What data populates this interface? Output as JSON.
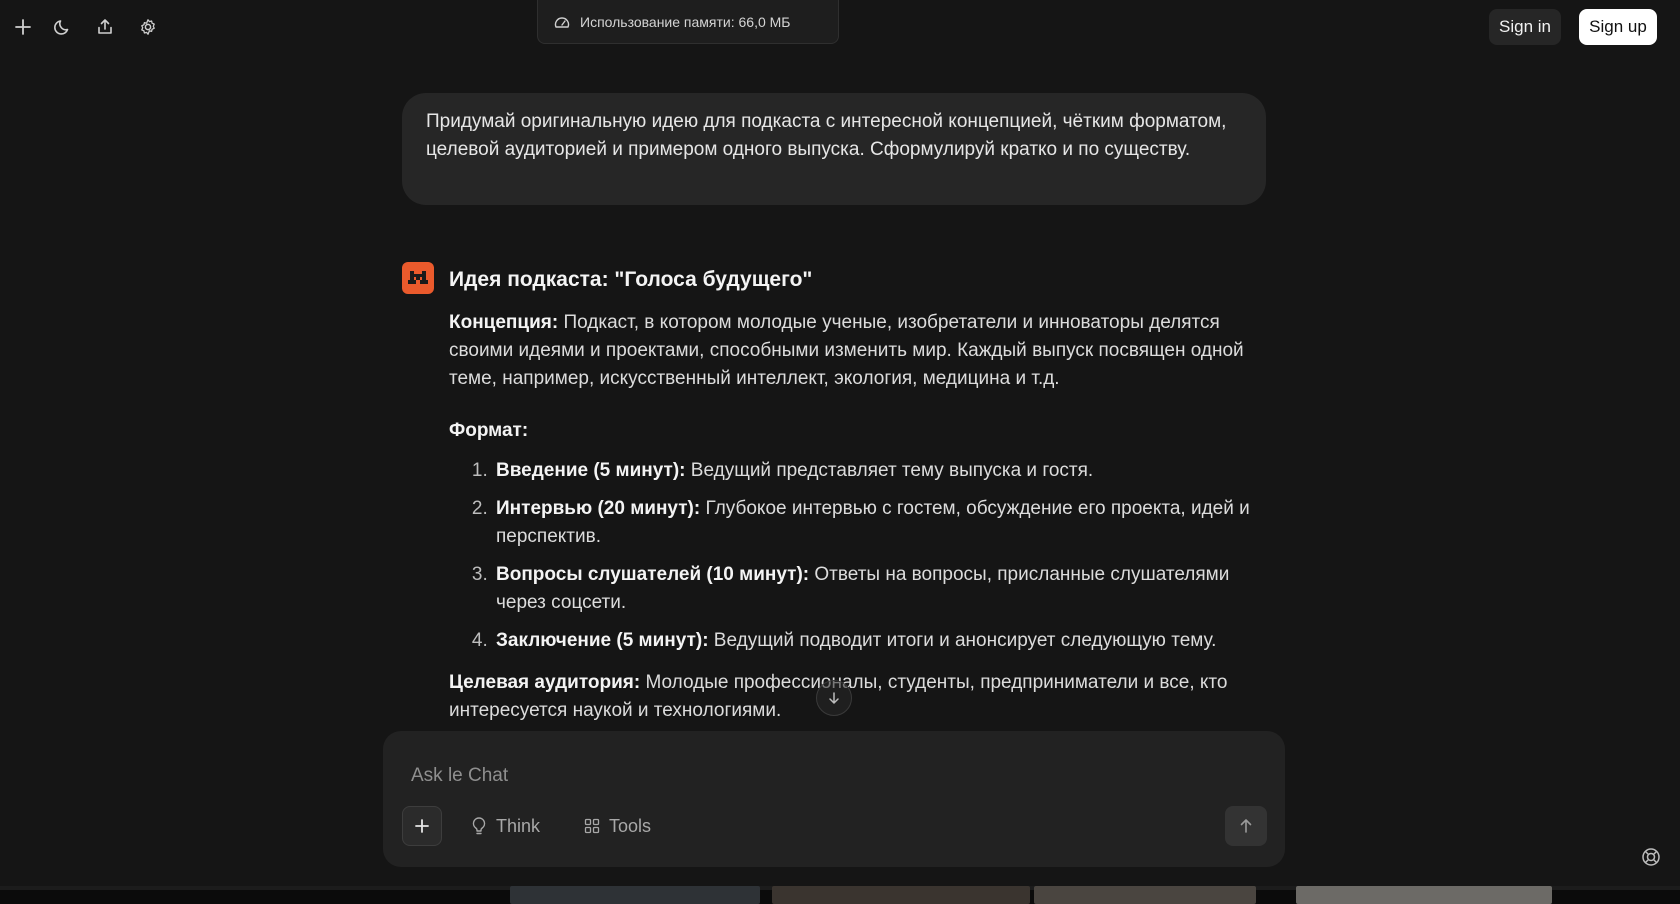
{
  "toolbar": {
    "new_chat_icon": "plus-icon",
    "theme_icon": "moon-icon",
    "share_icon": "share-icon",
    "settings_icon": "gear-icon"
  },
  "memory": {
    "icon": "gauge-icon",
    "text": "Использование памяти: 66,0 МБ"
  },
  "auth": {
    "sign_in": "Sign in",
    "sign_up": "Sign up"
  },
  "user_message": {
    "text": "Придумай оригинальную идею для подкаста с интересной концепцией, чётким форматом, целевой аудиторией и примером одного выпуска. Сформулируй кратко и по существу."
  },
  "assistant": {
    "avatar_icon": "cat-logo-icon",
    "heading": "Идея подкаста: \"Голоса будущего\"",
    "concept_label": "Концепция:",
    "concept_text": " Подкаст, в котором молодые ученые, изобретатели и инноваторы делятся своими идеями и проектами, способными изменить мир. Каждый выпуск посвящен одной теме, например, искусственный интеллект, экология, медицина и т.д.",
    "format_label": "Формат:",
    "format_items": [
      {
        "label": "Введение (5 минут):",
        "text": " Ведущий представляет тему выпуска и гостя."
      },
      {
        "label": "Интервью (20 минут):",
        "text": " Глубокое интервью с гостем, обсуждение его проекта, идей и перспектив."
      },
      {
        "label": "Вопросы слушателей (10 минут):",
        "text": " Ответы на вопросы, присланные слушателями через соцсети."
      },
      {
        "label": "Заключение (5 минут):",
        "text": " Ведущий подводит итоги и анонсирует следующую тему."
      }
    ],
    "audience_label": "Целевая аудитория:",
    "audience_text": " Молодые профессионалы, студенты, предприниматели и все, кто интересуется наукой и технологиями."
  },
  "composer": {
    "placeholder": "Ask le Chat",
    "add_icon": "plus-icon",
    "think_icon": "lightbulb-icon",
    "think_label": "Think",
    "tools_icon": "grid-icon",
    "tools_label": "Tools",
    "send_icon": "arrow-up-icon"
  },
  "help_icon": "lifebuoy-icon",
  "colors": {
    "background": "#151515",
    "bubble": "#262626",
    "composer": "#222222",
    "accent": "#ea5a2c"
  }
}
